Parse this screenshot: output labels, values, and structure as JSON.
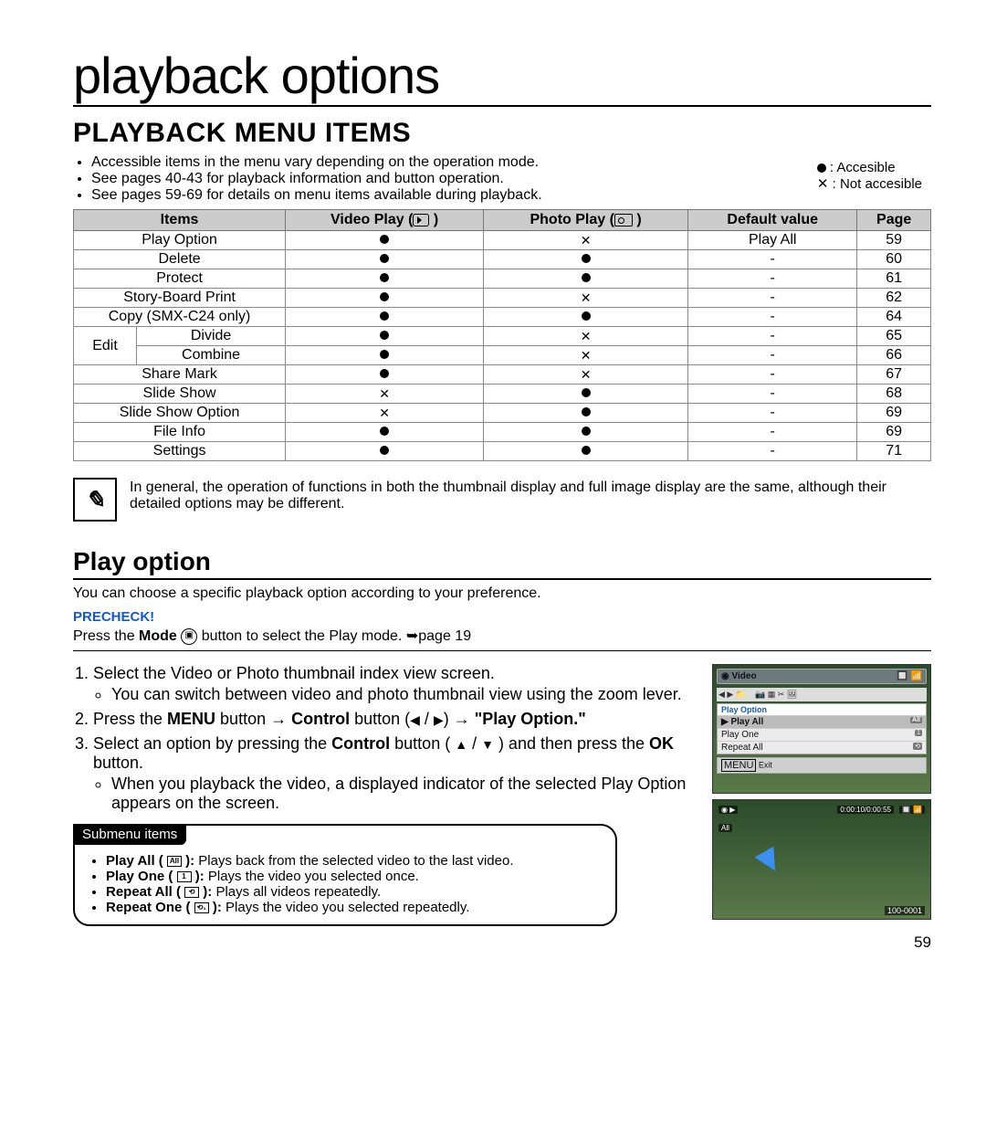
{
  "title": "playback options",
  "h2": "PLAYBACK MENU ITEMS",
  "intro": [
    "Accessible items in the menu vary depending on the operation mode.",
    "See pages 40-43 for playback information and button operation.",
    "See pages 59-69 for details on menu items available during playback."
  ],
  "legend": {
    "acc": ": Accesible",
    "nacc": ": Not accesible"
  },
  "table": {
    "headers": {
      "items": "Items",
      "video": "Video Play (",
      "photo": "Photo Play (",
      "def": "Default value",
      "page": "Page",
      "close": " )"
    }
  },
  "rows": {
    "r0": {
      "item": "Play Option",
      "v": "●",
      "p": "×",
      "def": "Play All",
      "pg": "59"
    },
    "r1": {
      "item": "Delete",
      "v": "●",
      "p": "●",
      "def": "-",
      "pg": "60"
    },
    "r2": {
      "item": "Protect",
      "v": "●",
      "p": "●",
      "def": "-",
      "pg": "61"
    },
    "r3": {
      "item": "Story-Board Print",
      "v": "●",
      "p": "×",
      "def": "-",
      "pg": "62"
    },
    "r4": {
      "item": "Copy (SMX-C24 only)",
      "v": "●",
      "p": "●",
      "def": "-",
      "pg": "64"
    },
    "edit": "Edit",
    "r5": {
      "item": "Divide",
      "v": "●",
      "p": "×",
      "def": "-",
      "pg": "65"
    },
    "r6": {
      "item": "Combine",
      "v": "●",
      "p": "×",
      "def": "-",
      "pg": "66"
    },
    "r7": {
      "item": "Share Mark",
      "v": "●",
      "p": "×",
      "def": "-",
      "pg": "67"
    },
    "r8": {
      "item": "Slide Show",
      "v": "×",
      "p": "●",
      "def": "-",
      "pg": "68"
    },
    "r9": {
      "item": "Slide Show Option",
      "v": "×",
      "p": "●",
      "def": "-",
      "pg": "69"
    },
    "r10": {
      "item": "File Info",
      "v": "●",
      "p": "●",
      "def": "-",
      "pg": "69"
    },
    "r11": {
      "item": "Settings",
      "v": "●",
      "p": "●",
      "def": "-",
      "pg": "71"
    }
  },
  "note": "In general, the operation of functions in both the thumbnail display and full image display are the same, although their detailed options may be different.",
  "playoption": {
    "title": "Play option",
    "desc": "You can choose a specific playback option according to your preference.",
    "precheck": "PRECHECK!",
    "mode_pre": "Press the ",
    "mode_bold": "Mode",
    "mode_mid": " button to select the Play mode. ",
    "mode_arrow": "➥",
    "mode_post": "page 19"
  },
  "steps": {
    "s1": "Select the Video or Photo thumbnail index view screen.",
    "s1a": "You can switch between video and photo thumbnail view using the zoom lever.",
    "s2a": "Press the ",
    "s2b": "MENU",
    "s2c": " button → ",
    "s2d": "Control",
    "s2e": " button (",
    "s2f": " / ",
    "s2g": ") → ",
    "s2h": "\"Play Option.\"",
    "s3a": "Select an option by pressing the ",
    "s3b": "Control",
    "s3c": " button ( ",
    "s3d": " / ",
    "s3e": " ) and then press the ",
    "s3f": "OK",
    "s3g": " button.",
    "s3sub": "When you playback the video, a displayed indicator of the selected Play Option appears on the screen."
  },
  "sub": {
    "tag": "Submenu items",
    "i1a": "Play All ( ",
    "i1b": " ): ",
    "i1c": "Plays back from the selected video to the last video.",
    "i1icon": "All",
    "i2a": "Play One ( ",
    "i2b": " ): ",
    "i2c": "Plays the video you selected once.",
    "i2icon": "1",
    "i3a": "Repeat All ( ",
    "i3b": " ): ",
    "i3c": "Plays all videos repeatedly.",
    "i3icon": "⟲",
    "i4a": "Repeat One ( ",
    "i4b": " ): ",
    "i4c": "Plays the video you selected repeatedly.",
    "i4icon": "⟲₁"
  },
  "shot1": {
    "title": "Video",
    "hdr": "Play Option",
    "o1": "Play All",
    "b1": "All",
    "o2": "Play One",
    "b2": "1",
    "o3": "Repeat All",
    "b3": "⟲",
    "exit": "MENU Exit"
  },
  "shot2": {
    "tl": "▶",
    "ts": "0:00:10/0:00:55",
    "all": "All",
    "br": "100-0001"
  },
  "pagenum": "59",
  "tri": {
    "l": "◀",
    "r": "▶",
    "u": "▲",
    "d": "▼"
  }
}
